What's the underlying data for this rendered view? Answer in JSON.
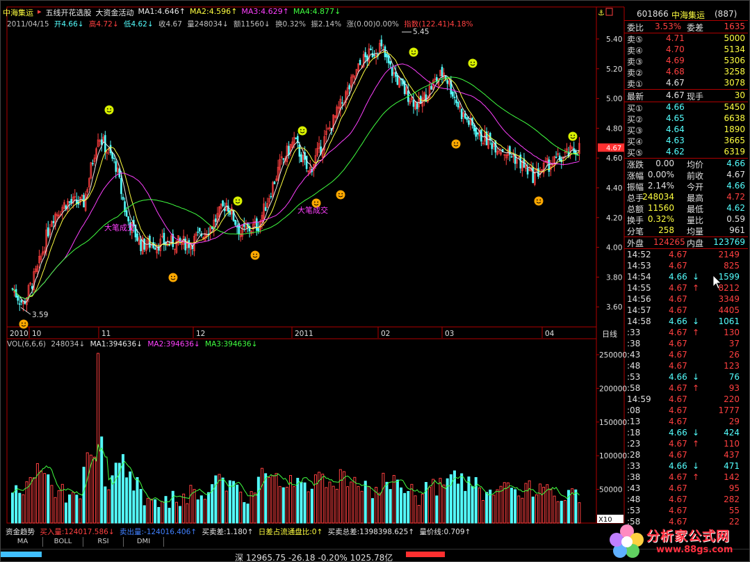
{
  "header": {
    "stock_name": "中海集运",
    "menu_items": [
      "五线开花选股",
      "大资金活动"
    ],
    "ma": [
      {
        "label": "MA1:4.646",
        "color": "#e8e8e8"
      },
      {
        "label": "MA2:4.596",
        "color": "#ffff40"
      },
      {
        "label": "MA3:4.629",
        "color": "#ff40ff"
      },
      {
        "label": "MA4:4.877",
        "color": "#40ff40"
      }
    ],
    "date": "2011/04/15",
    "open": "开4.66",
    "high": "高4.72",
    "low": "低4.62",
    "close": "收4.67",
    "volume": "量248034",
    "amount": "额11560",
    "turnover": "换0.32%",
    "amplitude": "振2.14%",
    "change": "涨(0.00)0.00%",
    "index": "指数(122.41)4.18%"
  },
  "chart": {
    "price_axis": [
      "5.40",
      "5.20",
      "5.00",
      "4.80",
      "4.60",
      "4.40",
      "4.20",
      "4.00",
      "3.80",
      "3.60"
    ],
    "date_axis": [
      "2010",
      "10",
      "11",
      "12",
      "2011",
      "02",
      "03",
      "04"
    ],
    "period_label": "日线",
    "current_price_label": "4.67",
    "annotations": {
      "high": "5.45",
      "low": "3.59",
      "big_trade_1": "大笔成交",
      "big_trade_2": "大笔成交"
    },
    "vol_axis": [
      "250000",
      "200000",
      "150000",
      "100000",
      "50000"
    ],
    "vol_unit": "X10"
  },
  "volume_header": {
    "title": "VOL(6,6,6)",
    "vol": "248034",
    "ma1": "MA1:394636",
    "ma2": "MA2:394636",
    "ma3": "MA3:394636"
  },
  "indicator_bar": {
    "title": "资金趋势",
    "buy": "买入量:124017.586",
    "sell": "卖出量:-124016.406",
    "diff": "买卖差:1.180",
    "ratio": "日差占流通盘比:0",
    "total": "买卖总差:1398398.625",
    "price_line": "量价线:0.709"
  },
  "tabs": [
    "MA",
    "BOLL",
    "RSI",
    "DMI"
  ],
  "status_bar": {
    "text": "深 12965.75 -26.18 -0.20% 1025.78亿"
  },
  "panel": {
    "code": "601866",
    "name": "中海集运",
    "num": "(887)",
    "weibi_label": "委比",
    "weibi": "3.53%",
    "weicha_label": "委差",
    "weicha": "1635",
    "sells": [
      {
        "label": "卖⑤",
        "price": "4.71",
        "vol": "5000"
      },
      {
        "label": "卖④",
        "price": "4.70",
        "vol": "5134"
      },
      {
        "label": "卖③",
        "price": "4.69",
        "vol": "5306"
      },
      {
        "label": "卖②",
        "price": "4.68",
        "vol": "3258"
      },
      {
        "label": "卖①",
        "price": "4.67",
        "vol": "3078"
      }
    ],
    "latest_label": "最新",
    "latest": "4.67",
    "xianshou_label": "现手",
    "xianshou": "30",
    "buys": [
      {
        "label": "买①",
        "price": "4.66",
        "vol": "5450"
      },
      {
        "label": "买②",
        "price": "4.65",
        "vol": "6638"
      },
      {
        "label": "买③",
        "price": "4.64",
        "vol": "1890"
      },
      {
        "label": "买④",
        "price": "4.63",
        "vol": "3665"
      },
      {
        "label": "买⑤",
        "price": "4.62",
        "vol": "6319"
      }
    ],
    "stats": [
      {
        "l1": "涨跌",
        "v1": "0.00",
        "l2": "均价",
        "v2": "4.66"
      },
      {
        "l1": "涨幅",
        "v1": "0.00%",
        "l2": "前收",
        "v2": "4.67"
      },
      {
        "l1": "振幅",
        "v1": "2.14%",
        "l2": "今开",
        "v2": "4.66"
      },
      {
        "l1": "总手",
        "v1": "248034",
        "l2": "最高",
        "v2": "4.72"
      },
      {
        "l1": "总额",
        "v1": "11560",
        "l2": "最低",
        "v2": "4.62"
      },
      {
        "l1": "换手",
        "v1": "0.32%",
        "l2": "量比",
        "v2": "0.59"
      },
      {
        "l1": "分笔",
        "v1": "258",
        "l2": "均量",
        "v2": "961"
      }
    ],
    "waipan_label": "外盘",
    "waipan": "124265",
    "neipan_label": "内盘",
    "neipan": "123769",
    "ticks": [
      {
        "t": "14:52",
        "p": "4.67",
        "a": "",
        "v": "2149",
        "c": "#ff4040"
      },
      {
        "t": "14:53",
        "p": "4.67",
        "a": "",
        "v": "825",
        "c": "#ff4040"
      },
      {
        "t": "14:54",
        "p": "4.66",
        "a": "↓",
        "v": "1599",
        "c": "#54ffff"
      },
      {
        "t": "14:55",
        "p": "4.67",
        "a": "↑",
        "v": "8212",
        "c": "#ff4040"
      },
      {
        "t": "14:56",
        "p": "4.67",
        "a": "",
        "v": "3349",
        "c": "#ff4040"
      },
      {
        "t": "14:57",
        "p": "4.67",
        "a": "",
        "v": "4405",
        "c": "#ff4040"
      },
      {
        "t": "14:58",
        "p": "4.66",
        "a": "↓",
        "v": "1061",
        "c": "#54ffff"
      },
      {
        "t": ":33",
        "p": "4.67",
        "a": "↑",
        "v": "130",
        "c": "#ff4040"
      },
      {
        "t": ":38",
        "p": "4.67",
        "a": "",
        "v": "37",
        "c": "#ff4040"
      },
      {
        "t": ":43",
        "p": "4.67",
        "a": "",
        "v": "26",
        "c": "#ff4040"
      },
      {
        "t": ":48",
        "p": "4.67",
        "a": "",
        "v": "123",
        "c": "#ff4040"
      },
      {
        "t": ":53",
        "p": "4.66",
        "a": "↓",
        "v": "76",
        "c": "#54ffff"
      },
      {
        "t": ":58",
        "p": "4.67",
        "a": "↑",
        "v": "93",
        "c": "#ff4040"
      },
      {
        "t": "14:59",
        "p": "4.67",
        "a": "",
        "v": "220",
        "c": "#ff4040"
      },
      {
        "t": ":08",
        "p": "4.67",
        "a": "",
        "v": "1777",
        "c": "#ff4040"
      },
      {
        "t": ":13",
        "p": "4.67",
        "a": "",
        "v": "29",
        "c": "#ff4040"
      },
      {
        "t": ":18",
        "p": "4.66",
        "a": "↓",
        "v": "424",
        "c": "#54ffff"
      },
      {
        "t": ":23",
        "p": "4.67",
        "a": "↑",
        "v": "110",
        "c": "#ff4040"
      },
      {
        "t": ":28",
        "p": "4.67",
        "a": "",
        "v": "437",
        "c": "#ff4040"
      },
      {
        "t": ":33",
        "p": "4.66",
        "a": "↓",
        "v": "471",
        "c": "#54ffff"
      },
      {
        "t": ":38",
        "p": "4.67",
        "a": "↑",
        "v": "142",
        "c": "#ff4040"
      },
      {
        "t": ":43",
        "p": "4.67",
        "a": "",
        "v": "95",
        "c": "#ff4040"
      },
      {
        "t": ":48",
        "p": "4.67",
        "a": "",
        "v": "282",
        "c": "#ff4040"
      },
      {
        "t": ":53",
        "p": "4.67",
        "a": "",
        "v": "55",
        "c": "#ff4040"
      },
      {
        "t": ":58",
        "p": "4.67",
        "a": "",
        "v": "22",
        "c": "#ff4040"
      }
    ]
  },
  "watermark": {
    "site": "分析家公式网",
    "url": "www.88gs.com"
  },
  "colors": {
    "up": "#ff4040",
    "down": "#54ffff",
    "grid": "#b00000",
    "ma1": "#e8e8e8",
    "ma2": "#ffff40",
    "ma3": "#ff40ff",
    "ma4": "#40ff40"
  }
}
